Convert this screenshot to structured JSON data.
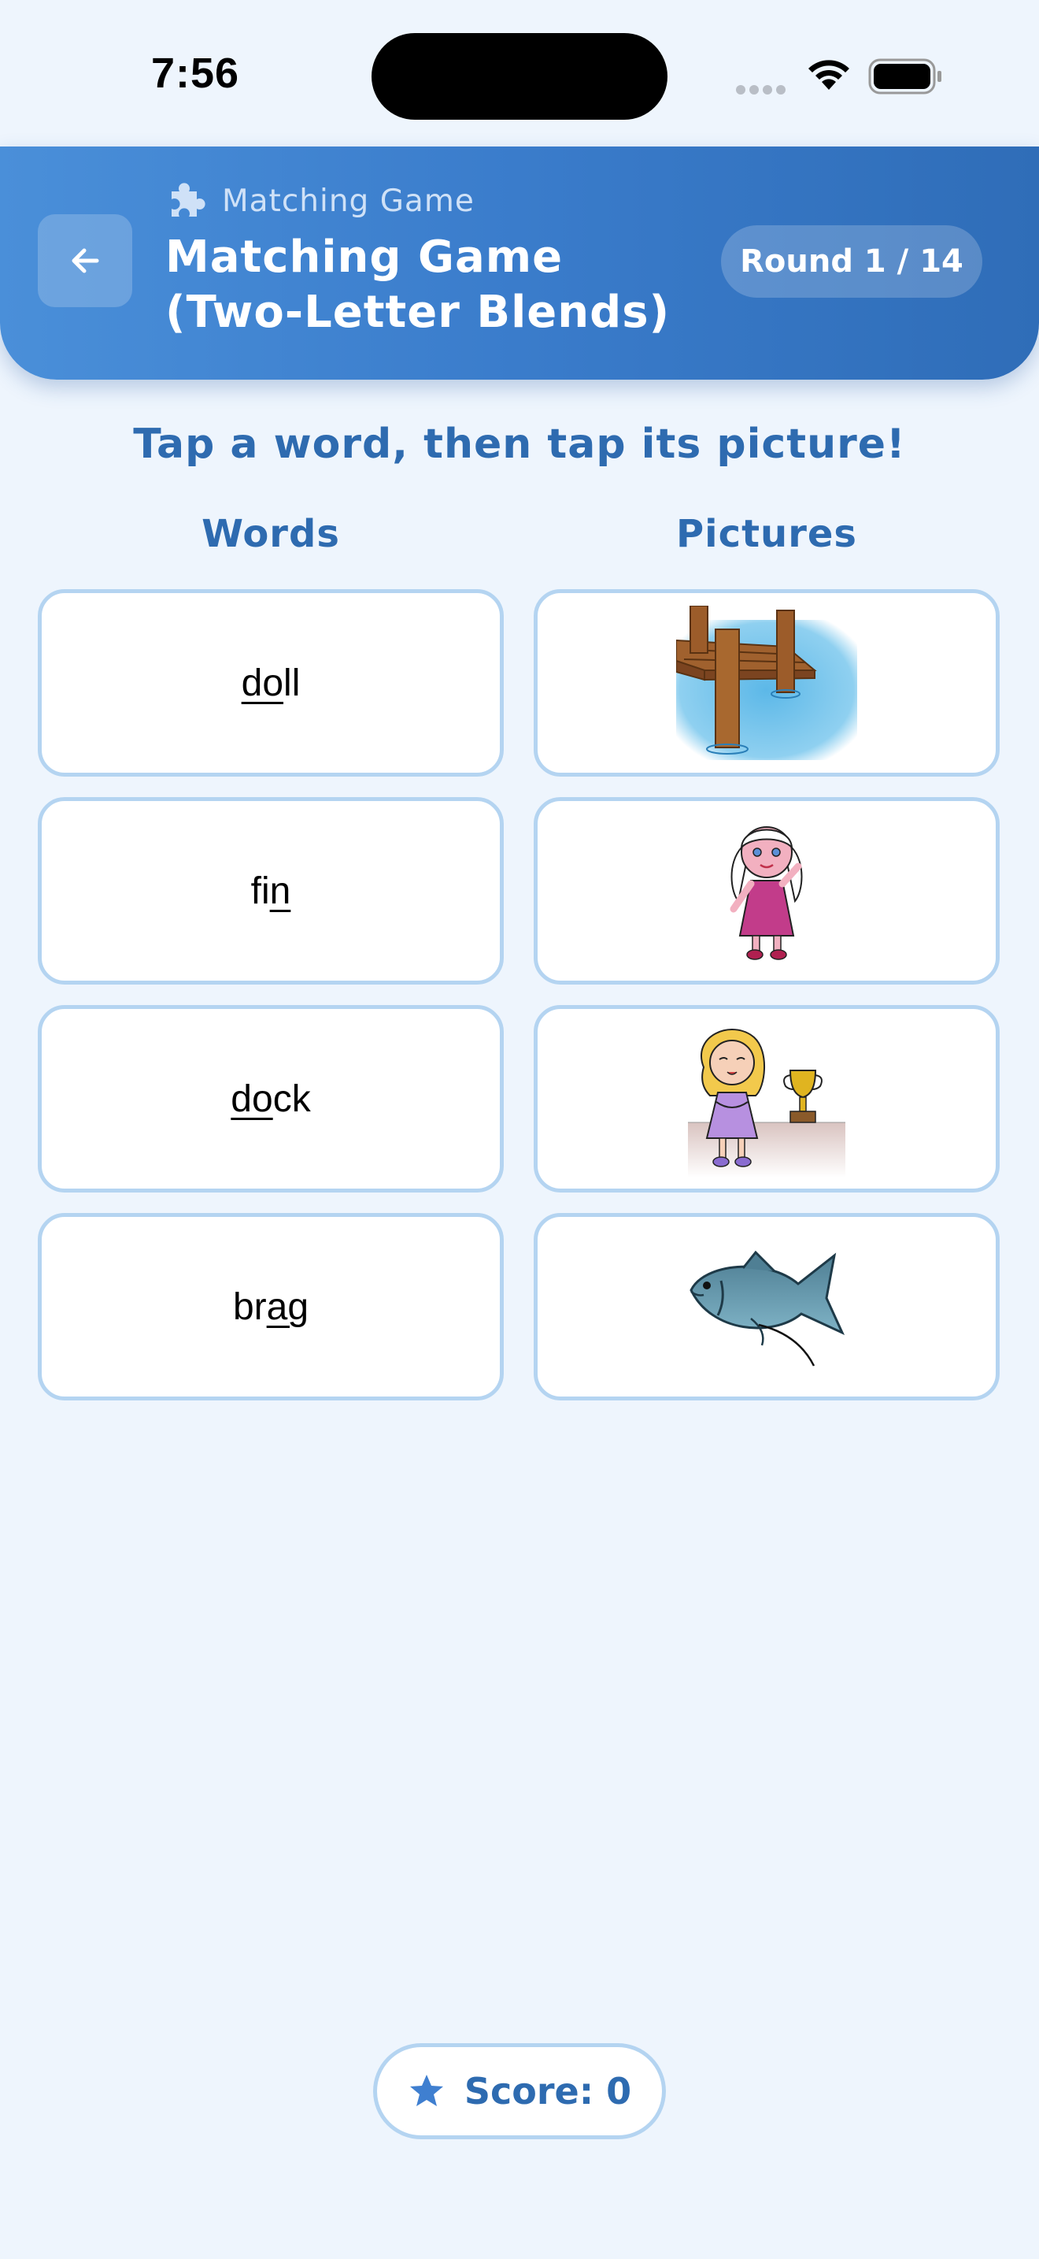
{
  "status_bar": {
    "time": "7:56"
  },
  "header": {
    "back_icon": "arrow-left-icon",
    "subtitle_icon": "puzzle-icon",
    "subtitle": "Matching Game",
    "title": "Matching Game (Two-Letter Blends)",
    "round": "Round 1 / 14"
  },
  "instruction": "Tap a word, then tap its picture!",
  "columns": {
    "words": "Words",
    "pictures": "Pictures"
  },
  "words": [
    {
      "pre": "",
      "underlined": "do",
      "post": "ll"
    },
    {
      "pre": "fi",
      "underlined": "n",
      "post": ""
    },
    {
      "pre": "",
      "underlined": "do",
      "post": "ck"
    },
    {
      "pre": "br",
      "underlined": "ag",
      "post": ""
    }
  ],
  "pictures": [
    {
      "icon": "dock-picture"
    },
    {
      "icon": "doll-picture"
    },
    {
      "icon": "girl-with-trophy-picture"
    },
    {
      "icon": "fish-picture"
    }
  ],
  "score": {
    "icon": "star-icon",
    "label": "Score: 0"
  },
  "colors": {
    "background": "#eef5fd",
    "header_start": "#4a8fd9",
    "header_end": "#2f6db8",
    "accent_text": "#2e6bb0",
    "card_border": "#b4d4f1"
  }
}
